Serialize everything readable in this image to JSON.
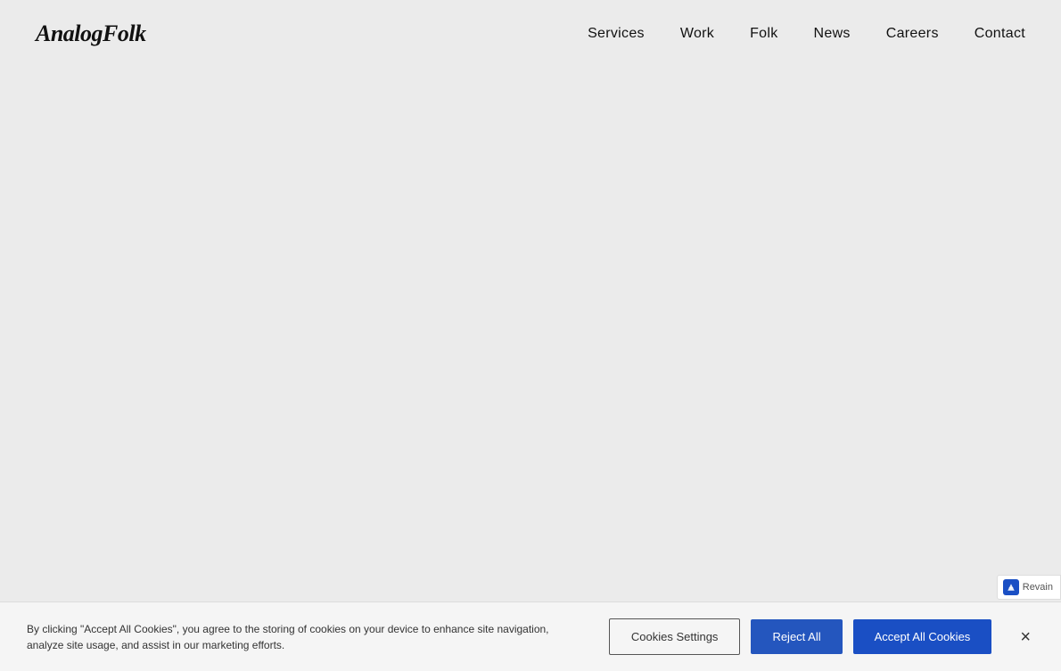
{
  "header": {
    "logo": "AnalogFolk",
    "nav": {
      "items": [
        {
          "label": "Services",
          "id": "services"
        },
        {
          "label": "Work",
          "id": "work"
        },
        {
          "label": "Folk",
          "id": "folk"
        },
        {
          "label": "News",
          "id": "news"
        },
        {
          "label": "Careers",
          "id": "careers"
        },
        {
          "label": "Contact",
          "id": "contact"
        }
      ]
    }
  },
  "cookie_banner": {
    "text": "By clicking \"Accept All Cookies\", you agree to the storing of cookies on your device to enhance site navigation, analyze site usage, and assist in our marketing efforts.",
    "buttons": {
      "settings": "Cookies Settings",
      "reject": "Reject All",
      "accept": "Accept All Cookies"
    },
    "close_icon": "×"
  },
  "revain": {
    "label": "Revain"
  }
}
